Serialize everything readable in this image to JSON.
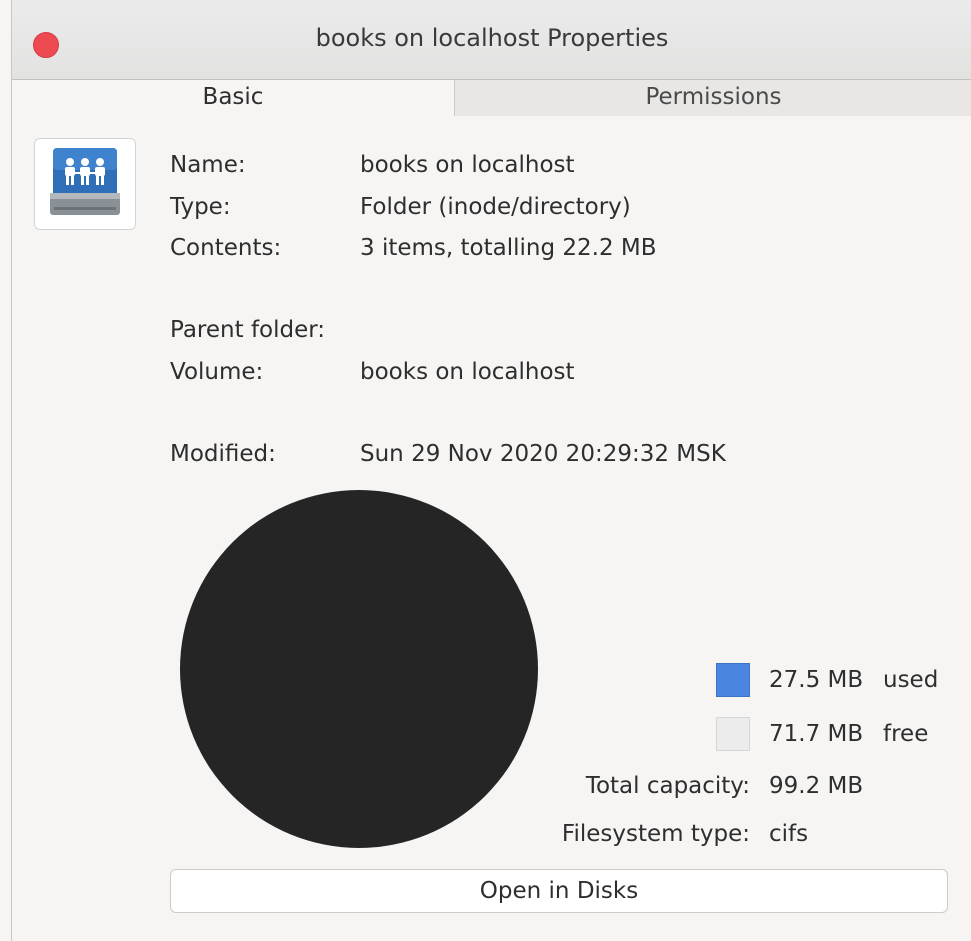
{
  "window": {
    "title": "books on localhost Properties"
  },
  "tabs": [
    {
      "label": "Basic",
      "active": true
    },
    {
      "label": "Permissions",
      "active": false
    }
  ],
  "icon": "network-share-drive-icon",
  "info": {
    "name_label": "Name:",
    "name_value": "books on localhost",
    "type_label": "Type:",
    "type_value": "Folder (inode/directory)",
    "contents_label": "Contents:",
    "contents_value": "3 items, totalling 22.2 MB",
    "parent_label": "Parent folder:",
    "volume_label": "Volume:",
    "volume_value": "books on localhost",
    "modified_label": "Modified:",
    "modified_value": "Sun 29 Nov 2020 20:29:32 MSK"
  },
  "usage": {
    "used_amount": "27.5 MB",
    "used_label": "used",
    "free_amount": "71.7 MB",
    "free_label": "free",
    "total_label": "Total capacity:",
    "total_value": "99.2 MB",
    "fs_label": "Filesystem type:",
    "fs_value": "cifs",
    "pie_color": "#252525",
    "used_color": "#4a86e0",
    "free_color": "#ececec"
  },
  "actions": {
    "open_disks_label": "Open in Disks"
  }
}
